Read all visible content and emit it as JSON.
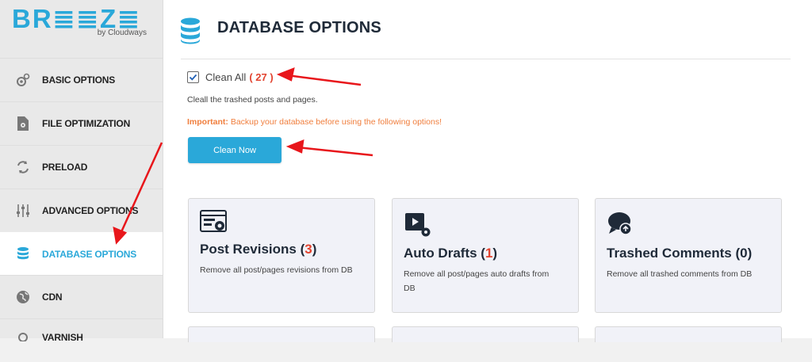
{
  "logo": {
    "word": "BR≣≣Z≣",
    "sub": "by Cloudways"
  },
  "sidebar": {
    "items": [
      {
        "label": "BASIC OPTIONS",
        "icon": "gear-icon"
      },
      {
        "label": "FILE OPTIMIZATION",
        "icon": "file-icon"
      },
      {
        "label": "PRELOAD",
        "icon": "refresh-icon"
      },
      {
        "label": "ADVANCED OPTIONS",
        "icon": "sliders-icon"
      },
      {
        "label": "DATABASE OPTIONS",
        "icon": "database-icon",
        "active": true
      },
      {
        "label": "CDN",
        "icon": "globe-icon"
      },
      {
        "label": "VARNISH",
        "icon": "varnish-icon"
      }
    ]
  },
  "header": {
    "title": "DATABASE OPTIONS"
  },
  "clean_all": {
    "label": "Clean All",
    "count": "( 27 )",
    "checked": true
  },
  "description": "Cleall the trashed posts and pages.",
  "important": {
    "prefix": "Important:",
    "text": " Backup your database before using the following options!"
  },
  "clean_button": "Clean Now",
  "cards": [
    {
      "title": "Post Revisions",
      "open": " (",
      "count": "3",
      "close": ")",
      "desc": "Remove all post/pages revisions from DB",
      "icon": "revisions-icon"
    },
    {
      "title": "Auto Drafts",
      "open": " (",
      "count": "1",
      "close": ")",
      "desc": "Remove all post/pages auto drafts from DB",
      "icon": "drafts-icon"
    },
    {
      "title": "Trashed Comments (0)",
      "open": "",
      "count": "",
      "close": "",
      "desc": "Remove all trashed comments from DB",
      "icon": "comments-icon"
    }
  ],
  "colors": {
    "accent": "#2aa8d9",
    "count_red": "#e2432f",
    "important_orange": "#f07e3d",
    "arrow_red": "#e8161b"
  }
}
